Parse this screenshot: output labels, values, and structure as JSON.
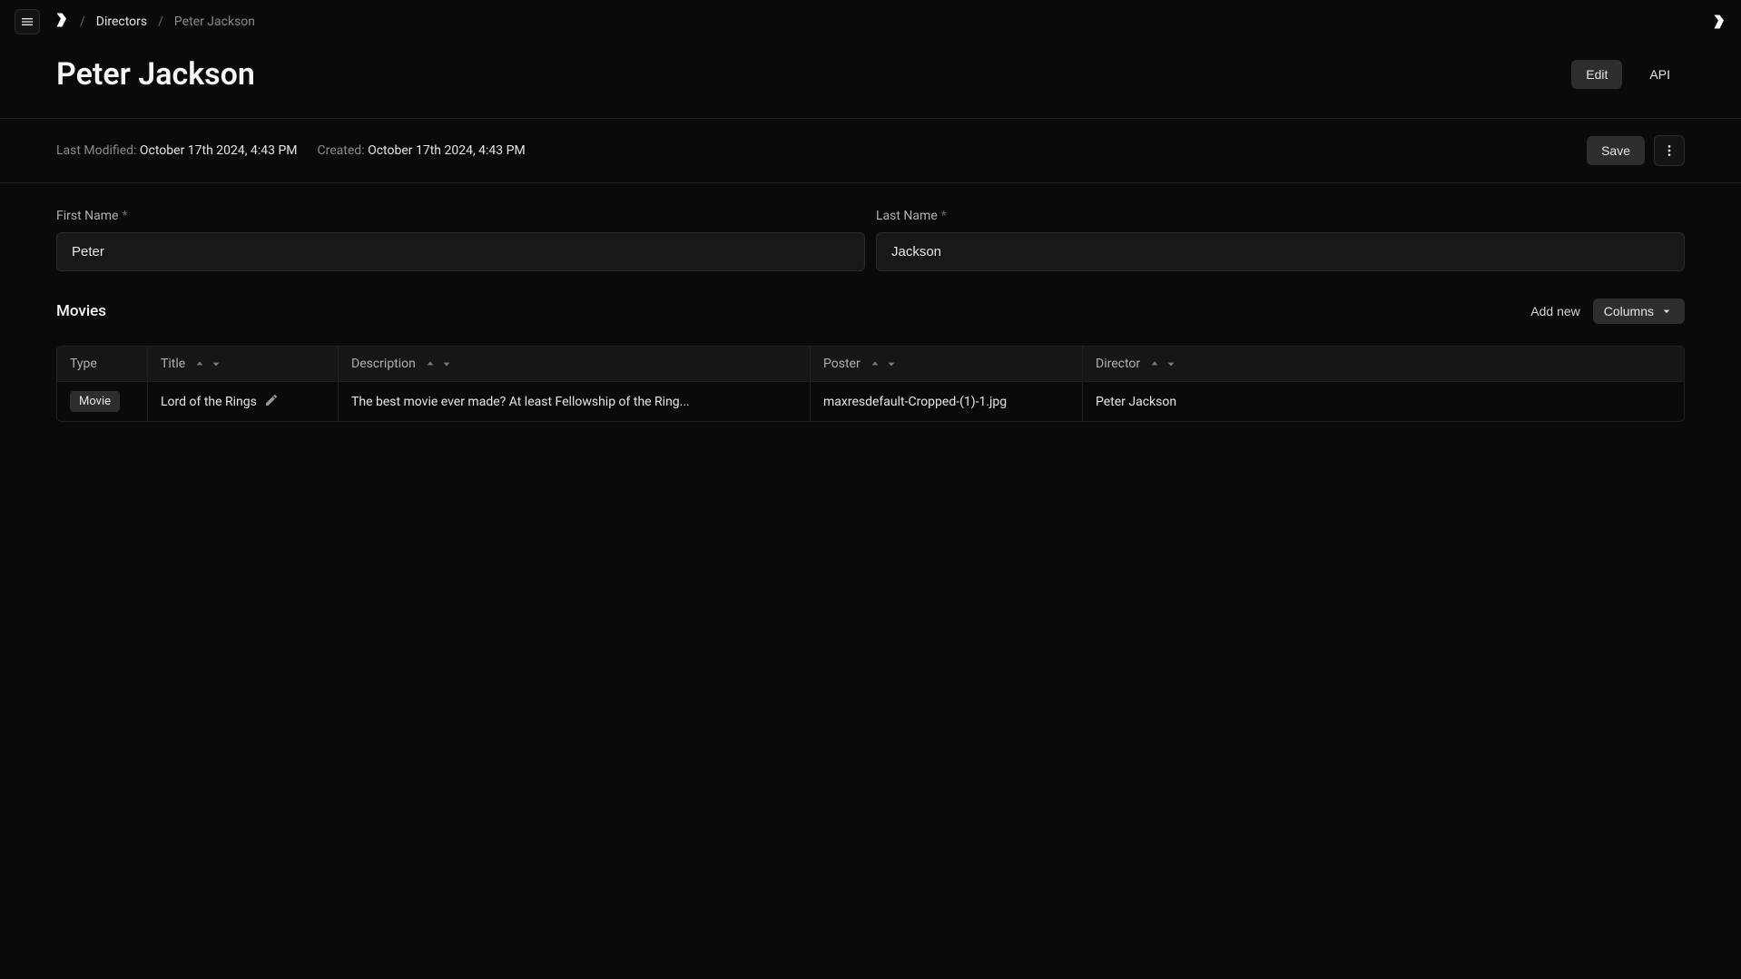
{
  "breadcrumb": {
    "root": "Directors",
    "current": "Peter Jackson"
  },
  "header": {
    "title": "Peter Jackson",
    "edit_label": "Edit",
    "api_label": "API"
  },
  "meta": {
    "last_modified_label": "Last Modified:",
    "last_modified_value": "October 17th 2024, 4:43 PM",
    "created_label": "Created:",
    "created_value": "October 17th 2024, 4:43 PM",
    "save_label": "Save"
  },
  "form": {
    "first_name_label": "First Name",
    "first_name_value": "Peter",
    "last_name_label": "Last Name",
    "last_name_value": "Jackson"
  },
  "movies": {
    "section_title": "Movies",
    "add_new_label": "Add new",
    "columns_label": "Columns",
    "headers": {
      "type": "Type",
      "title": "Title",
      "description": "Description",
      "poster": "Poster",
      "director": "Director"
    },
    "rows": [
      {
        "type": "Movie",
        "title": "Lord of the Rings",
        "description": "The best movie ever made? At least Fellowship of the Ring...",
        "poster": "maxresdefault-Cropped-(1)-1.jpg",
        "director": "Peter Jackson"
      }
    ]
  }
}
